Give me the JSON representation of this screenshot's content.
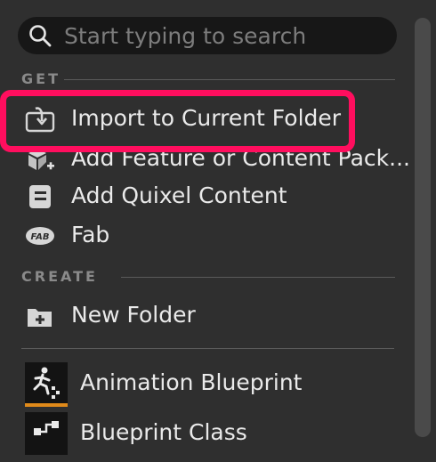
{
  "search": {
    "placeholder": "Start typing to search",
    "value": ""
  },
  "sections": {
    "get": {
      "label": "GET",
      "items": [
        {
          "label": "Import to Current Folder",
          "icon": "import-icon"
        },
        {
          "label": "Add Feature or Content Pack...",
          "icon": "feature-pack-icon"
        },
        {
          "label": "Add Quixel Content",
          "icon": "quixel-icon"
        },
        {
          "label": "Fab",
          "icon": "fab-icon"
        }
      ]
    },
    "create": {
      "label": "CREATE",
      "items": [
        {
          "label": "New Folder",
          "icon": "new-folder-icon"
        }
      ]
    },
    "assets": [
      {
        "label": "Animation Blueprint",
        "icon": "animation-blueprint-icon"
      },
      {
        "label": "Blueprint Class",
        "icon": "blueprint-class-icon"
      }
    ]
  },
  "colors": {
    "highlight": "#ff0e5e",
    "background": "#2f2f2f",
    "search_bg": "#171717",
    "accent": "#e08a1a"
  }
}
